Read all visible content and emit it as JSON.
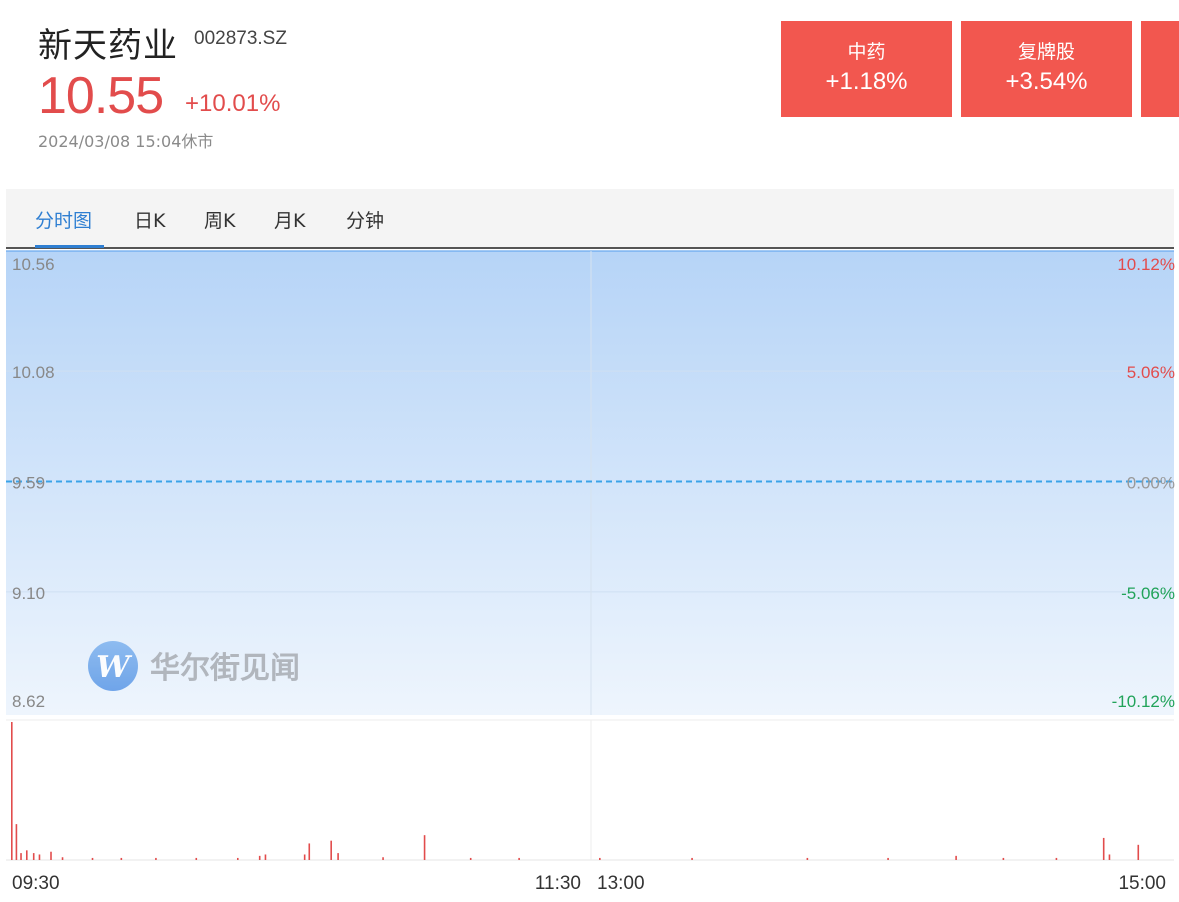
{
  "header": {
    "name": "新天药业",
    "code": "002873.SZ",
    "price": "10.55",
    "change_pct": "+10.01%",
    "timestamp": "2024/03/08 15:04休市"
  },
  "sectors": [
    {
      "name": "中药",
      "change": "+1.18%"
    },
    {
      "name": "复牌股",
      "change": "+3.54%"
    },
    {
      "name": "",
      "change": ""
    }
  ],
  "tabs": [
    "分时图",
    "日K",
    "周K",
    "月K",
    "分钟"
  ],
  "active_tab": "分时图",
  "watermark": "华尔街见闻",
  "colors": {
    "up": "#e24c4c",
    "down": "#21a35a",
    "accent": "#2f7fd2",
    "sector_bg": "#f2574f",
    "baseline": "#3aa3e8"
  },
  "chart_data": {
    "type": "area",
    "price_axis": {
      "left_ticks": [
        "10.56",
        "10.08",
        "9.59",
        "9.10",
        "8.62"
      ],
      "right_ticks": [
        "10.12%",
        "5.06%",
        "0.00%",
        "-5.06%",
        "-10.12%"
      ],
      "values": [
        10.56,
        10.08,
        9.59,
        9.1,
        8.62
      ],
      "baseline": 9.59,
      "ylim": [
        8.62,
        10.56
      ]
    },
    "price_series": {
      "values": [
        10.56,
        10.56
      ],
      "x": [
        "09:30",
        "15:00"
      ]
    },
    "time_ticks": [
      "09:30",
      "11:30",
      "13:00",
      "15:00"
    ],
    "volume": {
      "note": "relative volume bars, 0-1 scale of tallest",
      "bars": [
        {
          "t": 0.0,
          "v": 1.0
        },
        {
          "t": 0.004,
          "v": 0.26
        },
        {
          "t": 0.008,
          "v": 0.05
        },
        {
          "t": 0.013,
          "v": 0.07
        },
        {
          "t": 0.019,
          "v": 0.05
        },
        {
          "t": 0.024,
          "v": 0.04
        },
        {
          "t": 0.034,
          "v": 0.06
        },
        {
          "t": 0.044,
          "v": 0.02
        },
        {
          "t": 0.07,
          "v": 0.015
        },
        {
          "t": 0.095,
          "v": 0.015
        },
        {
          "t": 0.125,
          "v": 0.015
        },
        {
          "t": 0.16,
          "v": 0.015
        },
        {
          "t": 0.196,
          "v": 0.015
        },
        {
          "t": 0.215,
          "v": 0.03
        },
        {
          "t": 0.22,
          "v": 0.04
        },
        {
          "t": 0.254,
          "v": 0.04
        },
        {
          "t": 0.258,
          "v": 0.12
        },
        {
          "t": 0.277,
          "v": 0.14
        },
        {
          "t": 0.283,
          "v": 0.05
        },
        {
          "t": 0.322,
          "v": 0.02
        },
        {
          "t": 0.358,
          "v": 0.18
        },
        {
          "t": 0.398,
          "v": 0.015
        },
        {
          "t": 0.44,
          "v": 0.015
        },
        {
          "t": 0.51,
          "v": 0.015
        },
        {
          "t": 0.59,
          "v": 0.015
        },
        {
          "t": 0.69,
          "v": 0.015
        },
        {
          "t": 0.76,
          "v": 0.015
        },
        {
          "t": 0.819,
          "v": 0.03
        },
        {
          "t": 0.86,
          "v": 0.015
        },
        {
          "t": 0.906,
          "v": 0.015
        },
        {
          "t": 0.947,
          "v": 0.16
        },
        {
          "t": 0.952,
          "v": 0.04
        },
        {
          "t": 0.977,
          "v": 0.11
        }
      ]
    }
  }
}
